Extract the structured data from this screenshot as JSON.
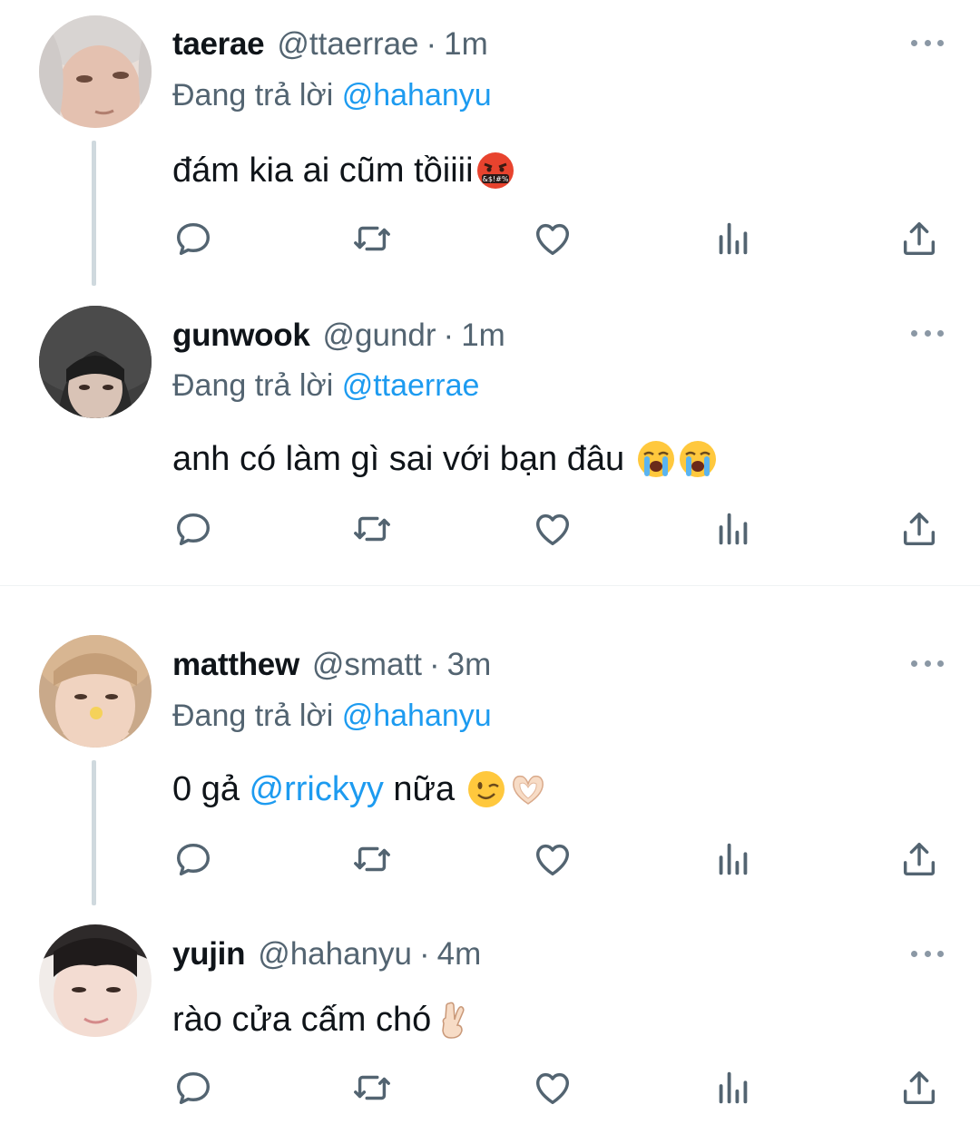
{
  "tweets": [
    {
      "name": "taerae",
      "handle": "@ttaerrae",
      "dot": "·",
      "time": "1m",
      "replying_prefix": "Đang trả lời ",
      "replying_to": "@hahanyu",
      "text": "đám kia ai cũm tồiiii",
      "emojis": [
        "face-with-symbols-on-mouth-emoji"
      ]
    },
    {
      "name": "gunwook",
      "handle": "@gundr",
      "dot": "·",
      "time": "1m",
      "replying_prefix": "Đang trả lời ",
      "replying_to": "@ttaerrae",
      "text": "anh có làm gì sai với bạn đâu ",
      "emojis": [
        "loudly-crying-face-emoji",
        "loudly-crying-face-emoji"
      ]
    },
    {
      "name": "matthew",
      "handle": "@smatt",
      "dot": "·",
      "time": "3m",
      "replying_prefix": "Đang trả lời ",
      "replying_to": "@hahanyu",
      "text_before": "0 gả ",
      "text_mention": "@rrickyy",
      "text_after": " nữa ",
      "emojis": [
        "winking-face-emoji",
        "heart-hands-emoji"
      ]
    },
    {
      "name": "yujin",
      "handle": "@hahanyu",
      "dot": "·",
      "time": "4m",
      "text": "rào cửa cấm chó",
      "emojis": [
        "crossed-fingers-emoji"
      ]
    }
  ],
  "actions": [
    "reply-icon",
    "retweet-icon",
    "like-icon",
    "views-icon",
    "share-icon"
  ],
  "colors": {
    "text": "#0f1419",
    "secondary": "#536471",
    "link": "#1d9bf0",
    "thread_line": "#cfd9de",
    "divider": "#eff3f4"
  }
}
